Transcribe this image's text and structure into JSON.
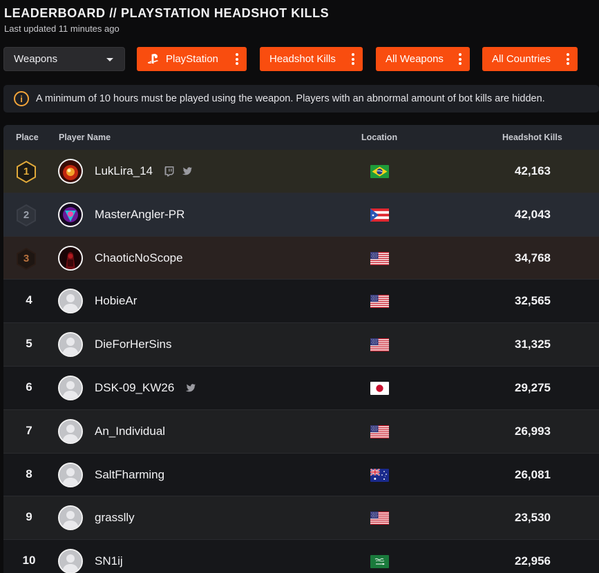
{
  "header": {
    "title": "LEADERBOARD // PLAYSTATION HEADSHOT KILLS",
    "updated": "Last updated 11 minutes ago"
  },
  "filters": {
    "category": "Weapons",
    "platform": "PlayStation",
    "stat": "Headshot Kills",
    "weapon": "All Weapons",
    "country": "All Countries"
  },
  "notice": {
    "icon": "i",
    "text": "A minimum of 10 hours must be played using the weapon. Players with an abnormal amount of bot kills are hidden."
  },
  "table": {
    "columns": {
      "place": "Place",
      "player": "Player Name",
      "location": "Location",
      "kills": "Headshot Kills"
    },
    "rows": [
      {
        "place": "1",
        "name": "LukLira_14",
        "location": "brazil-flag",
        "kills": "42,163",
        "social": [
          "twitch-icon",
          "twitter-icon"
        ]
      },
      {
        "place": "2",
        "name": "MasterAngler-PR",
        "location": "puerto-rico-flag",
        "kills": "42,043",
        "social": []
      },
      {
        "place": "3",
        "name": "ChaoticNoScope",
        "location": "usa-flag",
        "kills": "34,768",
        "social": []
      },
      {
        "place": "4",
        "name": "HobieAr",
        "location": "usa-flag",
        "kills": "32,565",
        "social": []
      },
      {
        "place": "5",
        "name": "DieForHerSins",
        "location": "usa-flag",
        "kills": "31,325",
        "social": []
      },
      {
        "place": "6",
        "name": "DSK-09_KW26",
        "location": "japan-flag",
        "kills": "29,275",
        "social": [
          "twitter-icon"
        ]
      },
      {
        "place": "7",
        "name": "An_Individual",
        "location": "usa-flag",
        "kills": "26,993",
        "social": []
      },
      {
        "place": "8",
        "name": "SaltFharming",
        "location": "australia-flag",
        "kills": "26,081",
        "social": []
      },
      {
        "place": "9",
        "name": "grasslly",
        "location": "usa-flag",
        "kills": "23,530",
        "social": []
      },
      {
        "place": "10",
        "name": "SN1ij",
        "location": "saudi-arabia-flag",
        "kills": "22,956",
        "social": []
      }
    ]
  },
  "colors": {
    "accent": "#f94d0f",
    "gold": "#e0a93a",
    "silver": "#9aa0ab",
    "bronze": "#b7713e",
    "warning": "#f2a43a"
  }
}
